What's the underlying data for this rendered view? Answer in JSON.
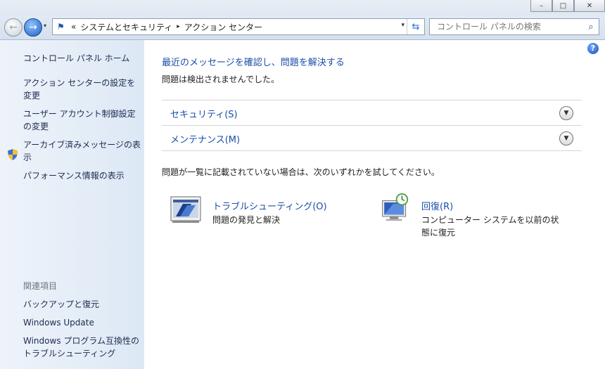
{
  "window": {
    "minimize": "–",
    "maximize": "□",
    "close": "✕"
  },
  "nav": {
    "recent_glyph": "▾",
    "crumb_prefix": "«",
    "crumbs": [
      "システムとセキュリティ",
      "アクション センター"
    ],
    "crumb_separator": "▸",
    "address_dropdown": "▾",
    "search_placeholder": "コントロール パネルの検索"
  },
  "sidebar": {
    "home": "コントロール パネル ホーム",
    "links": [
      "アクション センターの設定を変更",
      "ユーザー アカウント制御設定の変更",
      "アーカイブ済みメッセージの表示",
      "パフォーマンス情報の表示"
    ],
    "related_title": "関連項目",
    "related": [
      "バックアップと復元",
      "Windows Update",
      "Windows プログラム互換性のトラブルシューティング"
    ]
  },
  "main": {
    "help": "?",
    "headline": "最近のメッセージを確認し、問題を解決する",
    "status": "問題は検出されませんでした。",
    "sections": [
      {
        "label": "セキュリティ(S)"
      },
      {
        "label": "メンテナンス(M)"
      }
    ],
    "try_text": "問題が一覧に記載されていない場合は、次のいずれかを試してください。",
    "tools": [
      {
        "title": "トラブルシューティング(O)",
        "desc": "問題の発見と解決"
      },
      {
        "title": "回復(R)",
        "desc": "コンピューター システムを以前の状態に復元"
      }
    ]
  },
  "colors": {
    "link": "#1a4eaa",
    "sidebar_link": "#1c2b4f",
    "pane_bg": "#dde8f5"
  }
}
